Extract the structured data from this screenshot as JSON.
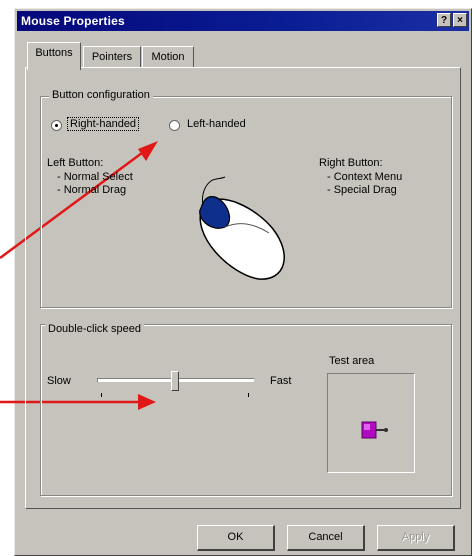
{
  "window": {
    "title": "Mouse Properties",
    "help_button": "?",
    "close_button": "×"
  },
  "tabs": [
    {
      "label": "Buttons",
      "active": true
    },
    {
      "label": "Pointers",
      "active": false
    },
    {
      "label": "Motion",
      "active": false
    }
  ],
  "button_configuration": {
    "label": "Button configuration",
    "right_handed": {
      "label": "Right-handed",
      "checked": true
    },
    "left_handed": {
      "label": "Left-handed",
      "checked": false
    },
    "left_button": {
      "title": "Left Button:",
      "line1": "- Normal Select",
      "line2": "- Normal Drag"
    },
    "right_button": {
      "title": "Right Button:",
      "line1": "- Context Menu",
      "line2": "- Special Drag"
    }
  },
  "double_click": {
    "label": "Double-click speed",
    "slow_label": "Slow",
    "fast_label": "Fast",
    "speed_fraction": 0.5,
    "test_area_label": "Test area"
  },
  "footer": {
    "ok_label": "OK",
    "cancel_label": "Cancel",
    "apply_label": "Apply"
  },
  "colors": {
    "dialog_bg": "#c6c3bd",
    "title_bar": "#05087a",
    "annotation_arrow": "#e01818",
    "mouse_left_button": "#0e2f8c",
    "test_box": "#b00ac0"
  }
}
